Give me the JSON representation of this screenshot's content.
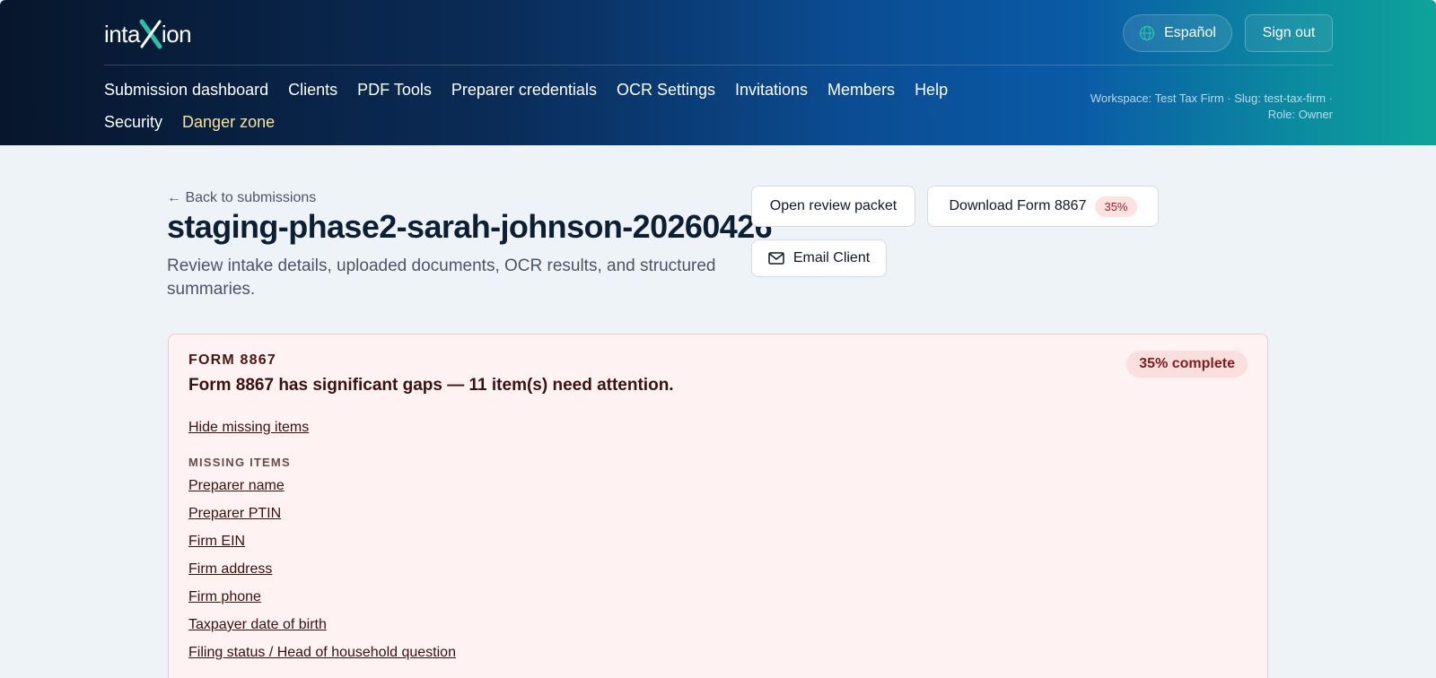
{
  "brand": {
    "name_pre": "inta",
    "name_post": "ion"
  },
  "header": {
    "language_label": "Español",
    "signout_label": "Sign out",
    "nav": [
      "Submission dashboard",
      "Clients",
      "PDF Tools",
      "Preparer credentials",
      "OCR Settings",
      "Invitations",
      "Members",
      "Help",
      "Security",
      "Danger zone"
    ],
    "workspace_line1": "Workspace: Test Tax Firm · Slug: test-tax-firm ·",
    "workspace_line2": "Role: Owner"
  },
  "page": {
    "back_label": "← Back to submissions",
    "title": "staging-phase2-sarah-johnson-20260426",
    "subtitle": "Review intake details, uploaded documents, OCR results, and structured summaries."
  },
  "actions": {
    "review_label": "Open review packet",
    "download_label": "Download Form 8867",
    "download_badge": "35%",
    "email_label": "Email Client"
  },
  "form_card": {
    "eyebrow": "FORM 8867",
    "headline": "Form 8867 has significant gaps — 11 item(s) need attention.",
    "complete_badge": "35% complete",
    "toggle_label": "Hide missing items",
    "missing_label": "MISSING ITEMS",
    "missing_items": [
      "Preparer name",
      "Preparer PTIN",
      "Firm EIN",
      "Firm address",
      "Firm phone",
      "Taxpayer date of birth",
      "Filing status / Head of household question"
    ]
  },
  "colors": {
    "danger_nav": "#f5e39a",
    "card_bg": "#fff2f2",
    "badge_bg": "#fde2e2"
  }
}
